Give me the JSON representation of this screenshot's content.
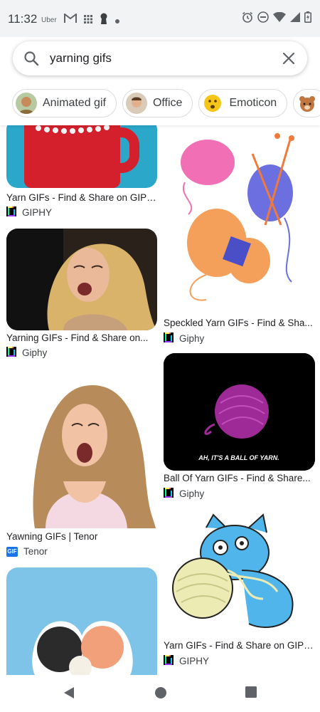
{
  "status": {
    "time": "11:32",
    "uber": "Uber"
  },
  "search": {
    "query": "yarning gifs"
  },
  "chips": [
    {
      "label": "Animated gif"
    },
    {
      "label": "Office"
    },
    {
      "label": "Emoticon"
    }
  ],
  "results": [
    {
      "title": "Yarn GIFs - Find & Share on GIPHY",
      "source": "GIPHY"
    },
    {
      "title": "Yarning GIFs - Find & Share on...",
      "source": "Giphy"
    },
    {
      "title": "Yawning GIFs | Tenor",
      "source": "Tenor",
      "favicon_text": "GIF"
    },
    {
      "title": "Speckled Yarn GIFs - Find & Sha...",
      "source": "Giphy"
    },
    {
      "title": "Ball Of Yarn GIFs - Find & Share...",
      "source": "Giphy",
      "caption": "AH, IT'S A BALL OF YARN."
    },
    {
      "title": "Yarn GIFs - Find & Share on GIPHY",
      "source": "GIPHY"
    }
  ],
  "colors": {
    "accent": "#1a73e8",
    "chip_border": "#dadce0",
    "status_bg": "#f1f3f4"
  }
}
